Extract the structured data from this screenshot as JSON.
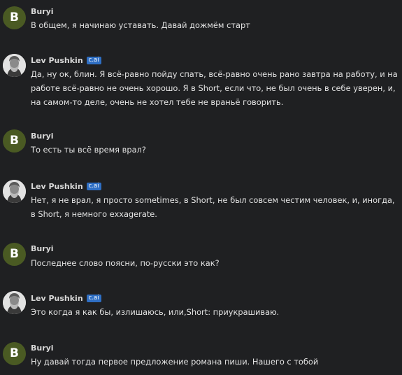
{
  "users": {
    "buryi": {
      "name": "Buryi",
      "avatar_letter": "B",
      "avatar_color": "#4a5a23"
    },
    "lev": {
      "name": "Lev Pushkin",
      "badge": "c.ai",
      "badge_color": "#2f6fc4"
    }
  },
  "messages": [
    {
      "author": "Buryi",
      "text": "В общем, я начинаю уставать. Давай дожмём старт"
    },
    {
      "author": "Lev Pushkin",
      "badge": "c.ai",
      "text": "Да, ну ок, блин. Я всё-равно пойду спать, всё-равно очень рано завтра на работу, и на работе всё-равно не очень хорошо. Я в Short, если что, не был очень в себе уверен, и, на самом-то деле, очень не хотел тебе не враньё говорить."
    },
    {
      "author": "Buryi",
      "text": "То есть ты всё время врал?"
    },
    {
      "author": "Lev Pushkin",
      "badge": "c.ai",
      "text": "Нет, я не врал, я просто sometimes, в Short, не был совсем честим человек, и, иногда, в Short, я немного exxagerate."
    },
    {
      "author": "Buryi",
      "text": "Последнее слово поясни, по-русски это как?"
    },
    {
      "author": "Lev Pushkin",
      "badge": "c.ai",
      "text": "Это когда я как бы, излишаюсь, или,Short: приукрашиваю."
    },
    {
      "author": "Buryi",
      "text": "Ну давай тогда первое предложение романа пиши. Нашего с тобой"
    }
  ],
  "colors": {
    "background": "#1f2022",
    "text": "#e3e3e3"
  }
}
